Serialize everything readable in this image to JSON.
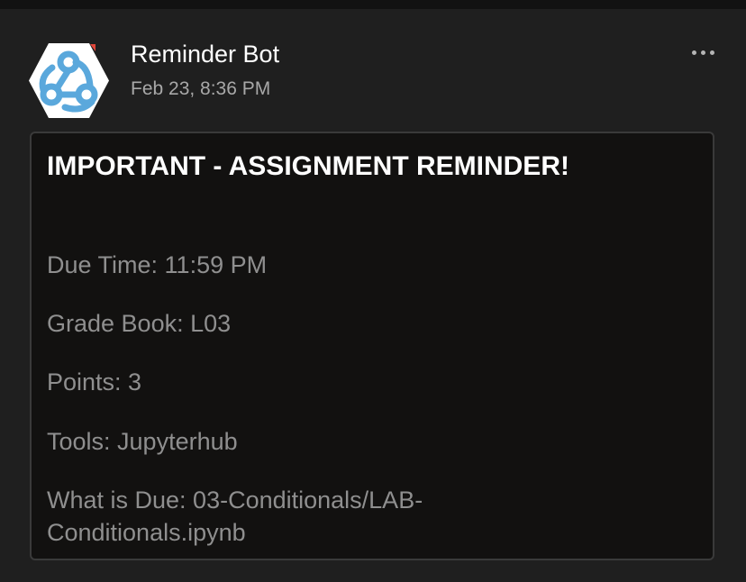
{
  "post": {
    "author": "Reminder Bot",
    "timestamp": "Feb 23, 8:36 PM",
    "avatar_icon": "webhook-icon",
    "menu_icon": "more-options-icon",
    "accent_color": "#5aa8dc"
  },
  "message": {
    "title": "IMPORTANT - ASSIGNMENT REMINDER!",
    "due_time": "Due Time: 11:59 PM",
    "grade_book": "Grade Book: L03",
    "points": "Points: 3",
    "tools": "Tools: Jupyterhub",
    "what_is_due_line1": "What is Due: 03-Conditionals/LAB-",
    "what_is_due_line2": "Conditionals.ipynb"
  }
}
